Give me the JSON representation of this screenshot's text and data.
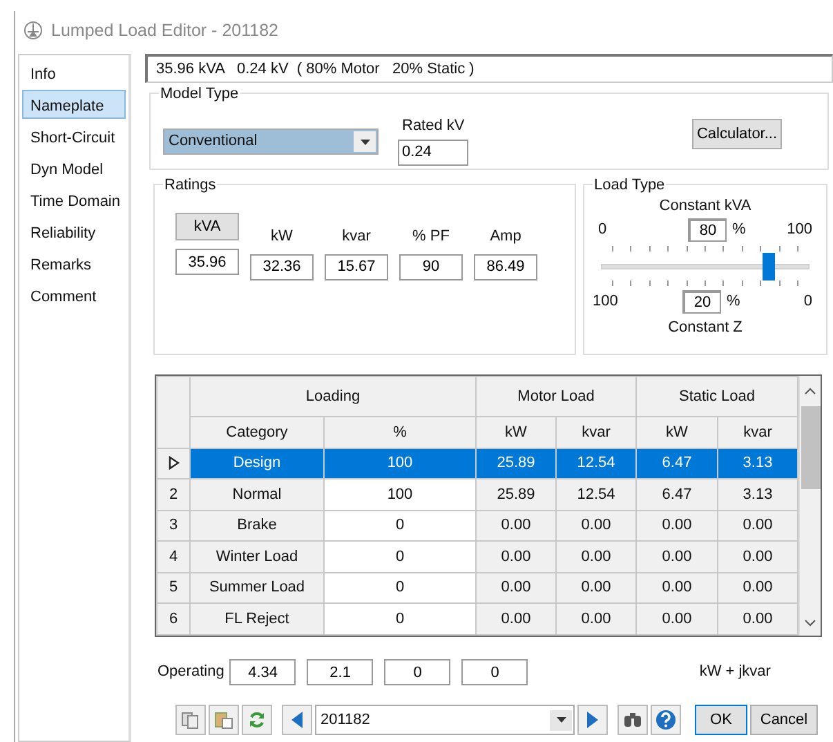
{
  "window": {
    "title": "Lumped Load Editor - 201182"
  },
  "sidebar": {
    "items": [
      {
        "label": "Info",
        "selected": false
      },
      {
        "label": "Nameplate",
        "selected": true
      },
      {
        "label": "Short-Circuit",
        "selected": false
      },
      {
        "label": "Dyn Model",
        "selected": false
      },
      {
        "label": "Time Domain",
        "selected": false
      },
      {
        "label": "Reliability",
        "selected": false
      },
      {
        "label": "Remarks",
        "selected": false
      },
      {
        "label": "Comment",
        "selected": false
      }
    ]
  },
  "summary": "35.96 kVA   0.24 kV  ( 80% Motor   20% Static )",
  "model_type": {
    "title": "Model Type",
    "value": "Conventional"
  },
  "rated_kv": {
    "label": "Rated kV",
    "value": "0.24"
  },
  "calculator_button": "Calculator...",
  "ratings": {
    "title": "Ratings",
    "columns": [
      {
        "label": "kVA",
        "kind": "button",
        "value": "35.96"
      },
      {
        "label": "kW",
        "kind": "label",
        "value": "32.36"
      },
      {
        "label": "kvar",
        "kind": "label",
        "value": "15.67"
      },
      {
        "label": "% PF",
        "kind": "label",
        "value": "90"
      },
      {
        "label": "Amp",
        "kind": "label",
        "value": "86.49"
      }
    ]
  },
  "load_type": {
    "title": "Load Type",
    "top_label": "Constant kVA",
    "top_min": "0",
    "top_value": "80",
    "top_unit": "%",
    "top_max": "100",
    "level": 0.8,
    "bottom_min": "100",
    "bottom_value": "20",
    "bottom_unit": "%",
    "bottom_max": "0",
    "bottom_label": "Constant Z"
  },
  "table": {
    "groups": [
      {
        "label": "Loading"
      },
      {
        "label": "Motor Load"
      },
      {
        "label": "Static Load"
      }
    ],
    "columns": [
      "Category",
      "%",
      "kW",
      "kvar",
      "kW",
      "kvar"
    ],
    "rows": [
      {
        "current": true,
        "selected": true,
        "cells": [
          "Design",
          "100",
          "25.89",
          "12.54",
          "6.47",
          "3.13"
        ]
      },
      {
        "number": "2",
        "selected": false,
        "cells": [
          "Normal",
          "100",
          "25.89",
          "12.54",
          "6.47",
          "3.13"
        ]
      },
      {
        "number": "3",
        "selected": false,
        "cells": [
          "Brake",
          "0",
          "0.00",
          "0.00",
          "0.00",
          "0.00"
        ]
      },
      {
        "number": "4",
        "selected": false,
        "cells": [
          "Winter Load",
          "0",
          "0.00",
          "0.00",
          "0.00",
          "0.00"
        ]
      },
      {
        "number": "5",
        "selected": false,
        "cells": [
          "Summer Load",
          "0",
          "0.00",
          "0.00",
          "0.00",
          "0.00"
        ]
      },
      {
        "number": "6",
        "selected": false,
        "cells": [
          "FL Reject",
          "0",
          "0.00",
          "0.00",
          "0.00",
          "0.00"
        ]
      }
    ]
  },
  "operating": {
    "label": "Operating",
    "values": [
      "4.34",
      "2.1",
      "0",
      "0"
    ],
    "unit": "kW + jkvar"
  },
  "footer": {
    "record": "201182",
    "buttons": [
      {
        "label": "OK",
        "kind": "default"
      },
      {
        "label": "Cancel",
        "kind": "normal"
      }
    ]
  }
}
